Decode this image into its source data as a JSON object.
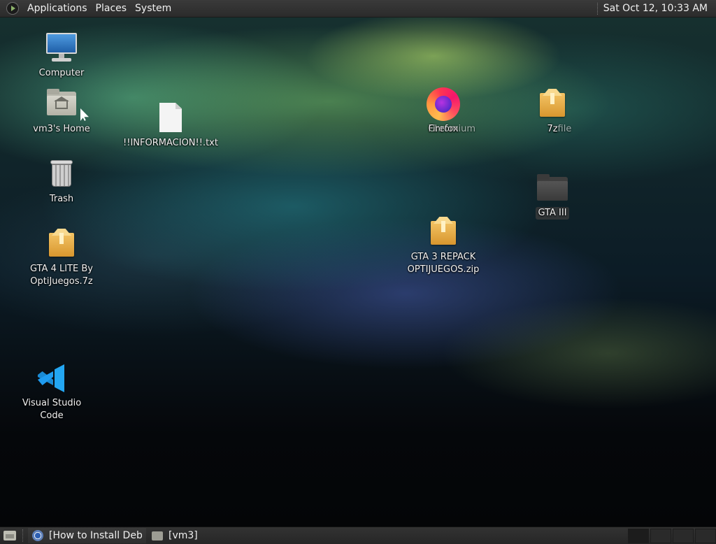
{
  "top_panel": {
    "menus": [
      "Applications",
      "Places",
      "System"
    ],
    "clock": "Sat Oct 12, 10:33 AM"
  },
  "desktop": {
    "icons": {
      "computer": "Computer",
      "home": "vm3's Home",
      "informacion": "!!INFORMACION!!.txt",
      "trash": "Trash",
      "gta4": "GTA 4 LITE By OptiJuegos.7z",
      "gta3_repack": "GTA 3 REPACK OPTIJUEGOS.zip",
      "firefox_a": "Firefox",
      "firefox_b": "Chromium",
      "archive_a": "7z",
      "archive_b": "7zfile",
      "gta3_folder": "GTA III",
      "vscode": "Visual Studio Code"
    }
  },
  "taskbar": {
    "tasks": [
      "[How to Install Debi...",
      "[vm3]"
    ],
    "workspace_count": 4
  }
}
